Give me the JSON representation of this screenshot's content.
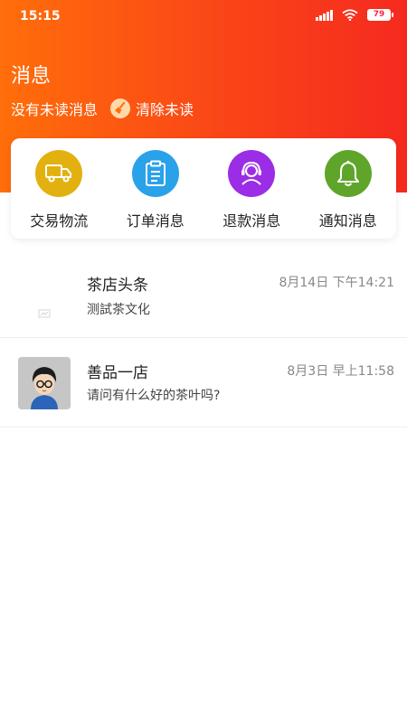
{
  "status_bar": {
    "time": "15:15",
    "battery": "79"
  },
  "header": {
    "title": "消息",
    "no_unread": "没有未读消息",
    "clear_unread": "清除未读"
  },
  "quick_entries": [
    {
      "label": "交易物流",
      "icon": "truck-icon",
      "color": "#e2b10f"
    },
    {
      "label": "订单消息",
      "icon": "clipboard-icon",
      "color": "#2aa2ea"
    },
    {
      "label": "退款消息",
      "icon": "customer-service-icon",
      "color": "#9b2de6"
    },
    {
      "label": "通知消息",
      "icon": "bell-icon",
      "color": "#5fa52a"
    }
  ],
  "messages": [
    {
      "name": "茶店头条",
      "time": "8月14日 下午14:21",
      "preview": "测試茶文化",
      "avatar": "broken-image-icon"
    },
    {
      "name": "善品一店",
      "time": "8月3日 早上11:58",
      "preview": "请问有什么好的茶叶吗?",
      "avatar": "avatar"
    }
  ],
  "colors": {
    "header_gradient_start": "#ff6e0a",
    "header_gradient_end": "#f52a1f"
  }
}
